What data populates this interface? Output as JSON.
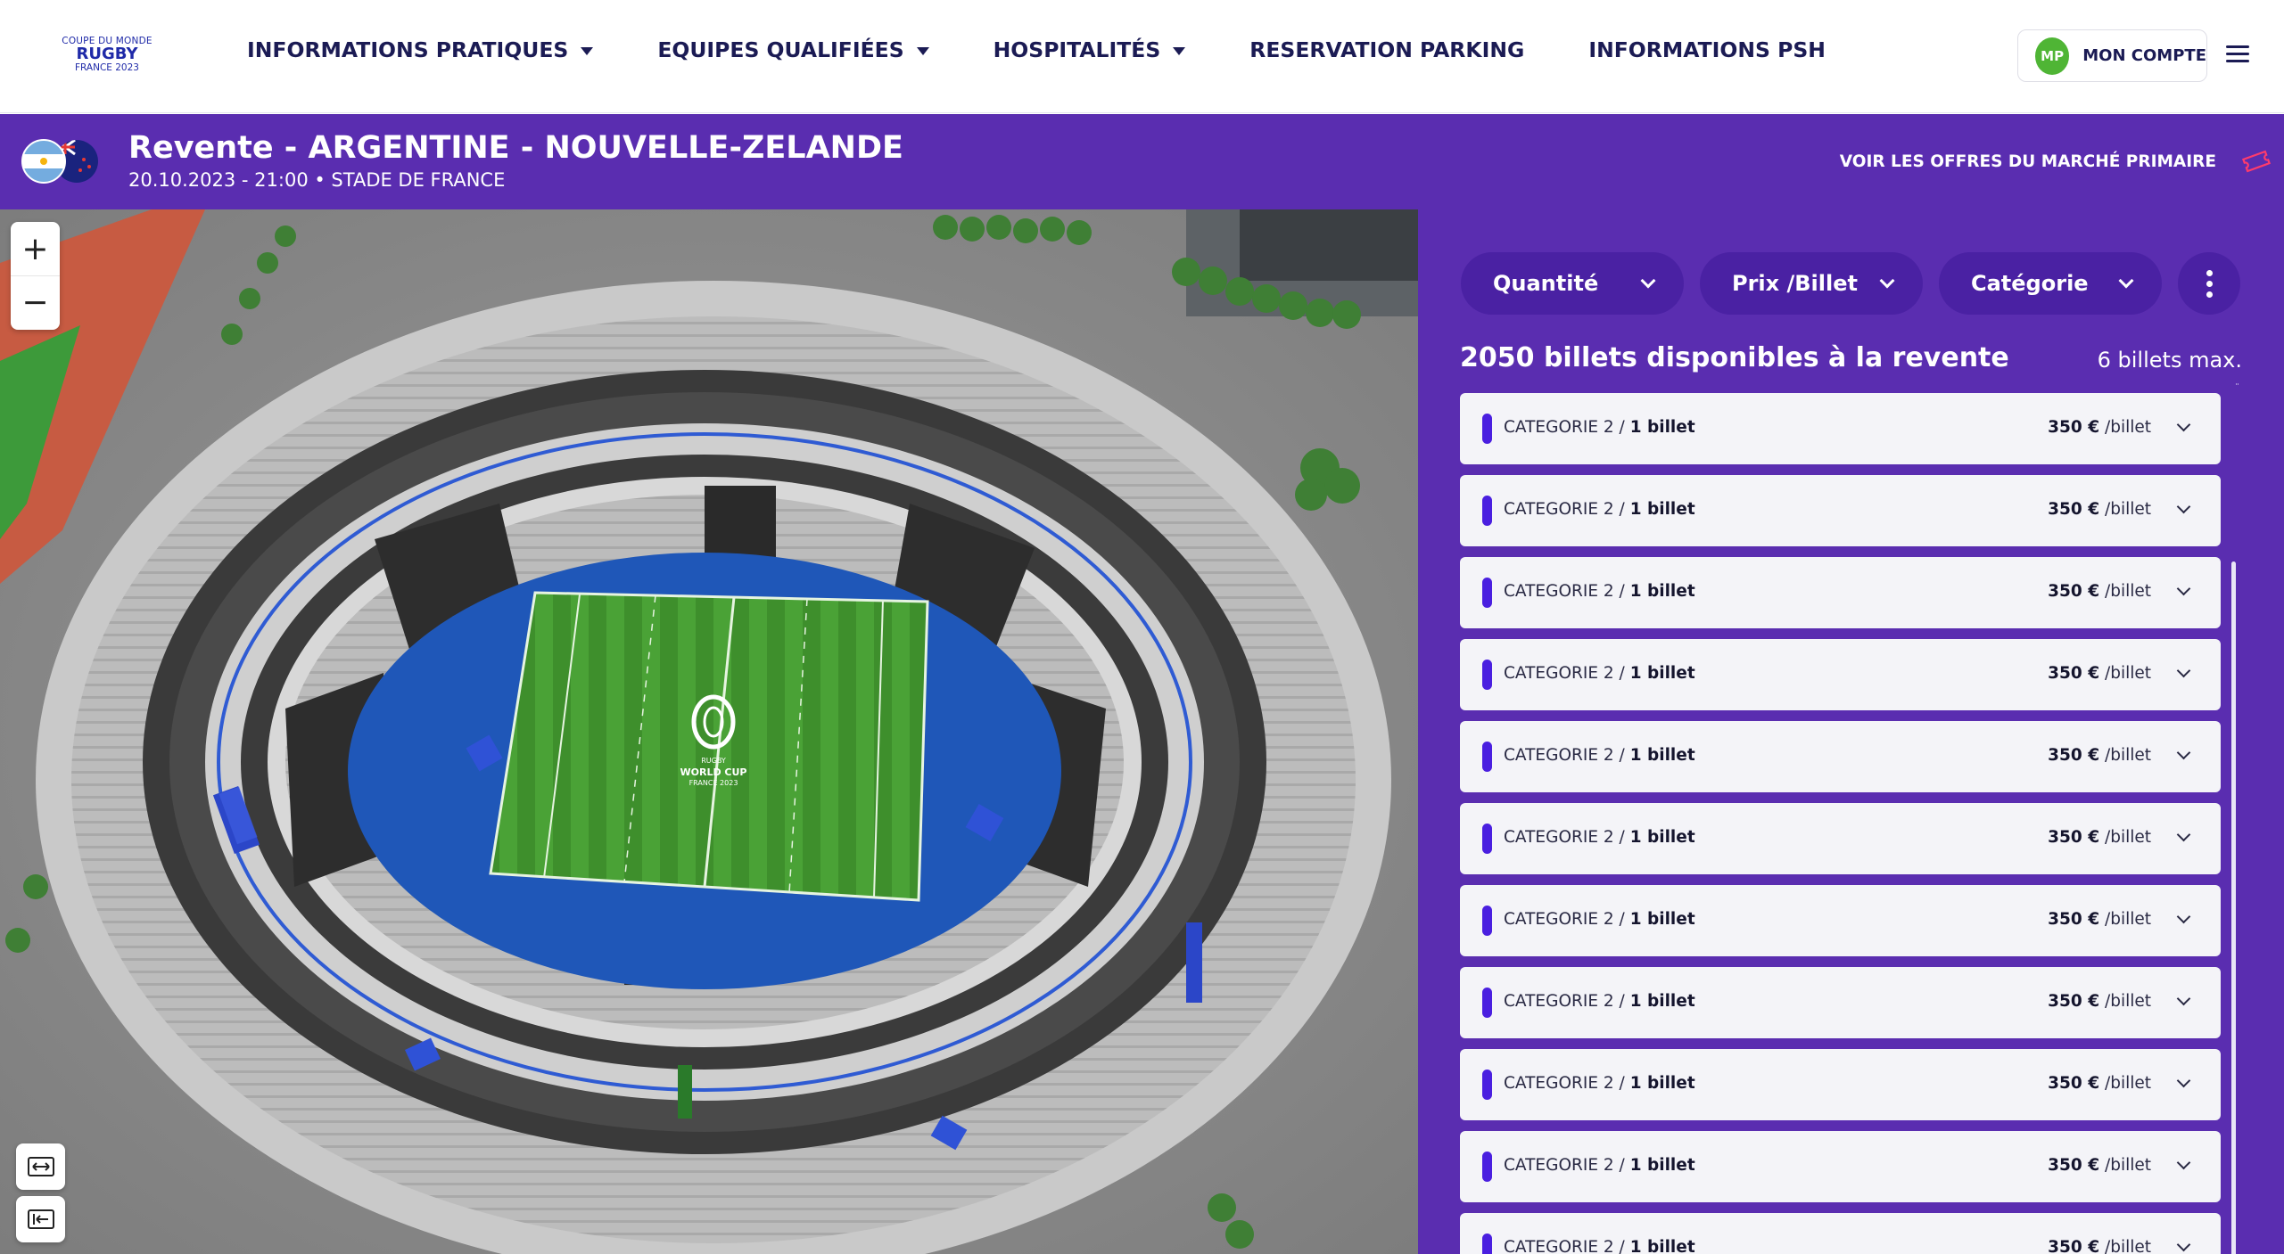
{
  "brand": {
    "logo_line1": "COUPE DU MONDE",
    "logo_line2": "RUGBY",
    "logo_line3": "FRANCE 2023"
  },
  "nav": {
    "items": [
      {
        "label": "INFORMATIONS PRATIQUES",
        "dropdown": true
      },
      {
        "label": "EQUIPES QUALIFIÉES",
        "dropdown": true
      },
      {
        "label": "HOSPITALITÉS",
        "dropdown": true
      },
      {
        "label": "RESERVATION PARKING",
        "dropdown": false
      },
      {
        "label": "INFORMATIONS PSH",
        "dropdown": false
      }
    ],
    "account_initials": "MP",
    "account_label": "MON COMPTE"
  },
  "event": {
    "title": "Revente - ARGENTINE - NOUVELLE-ZELANDE",
    "subtitle": "20.10.2023 - 21:00 • STADE DE FRANCE",
    "primary_market_link": "VOIR LES OFFRES DU MARCHÉ PRIMAIRE"
  },
  "map": {
    "zoom_in": "+",
    "zoom_out": "−",
    "pitch_logo_line1": "RUGBY",
    "pitch_logo_line2": "WORLD CUP",
    "pitch_logo_line3": "FRANCE 2023"
  },
  "filters": {
    "quantity": "Quantité",
    "price": "Prix /Billet",
    "category": "Catégorie"
  },
  "listing": {
    "available": "2050 billets disponibles à la revente",
    "max": "6 billets max.",
    "tickets": [
      {
        "category": "CATEGORIE 2 /",
        "qty": "1 billet",
        "price": "350 €",
        "unit": "/billet"
      },
      {
        "category": "CATEGORIE 2 /",
        "qty": "1 billet",
        "price": "350 €",
        "unit": "/billet"
      },
      {
        "category": "CATEGORIE 2 /",
        "qty": "1 billet",
        "price": "350 €",
        "unit": "/billet"
      },
      {
        "category": "CATEGORIE 2 /",
        "qty": "1 billet",
        "price": "350 €",
        "unit": "/billet"
      },
      {
        "category": "CATEGORIE 2 /",
        "qty": "1 billet",
        "price": "350 €",
        "unit": "/billet"
      },
      {
        "category": "CATEGORIE 2 /",
        "qty": "1 billet",
        "price": "350 €",
        "unit": "/billet"
      },
      {
        "category": "CATEGORIE 2 /",
        "qty": "1 billet",
        "price": "350 €",
        "unit": "/billet"
      },
      {
        "category": "CATEGORIE 2 /",
        "qty": "1 billet",
        "price": "350 €",
        "unit": "/billet"
      },
      {
        "category": "CATEGORIE 2 /",
        "qty": "1 billet",
        "price": "350 €",
        "unit": "/billet"
      },
      {
        "category": "CATEGORIE 2 /",
        "qty": "1 billet",
        "price": "350 €",
        "unit": "/billet"
      },
      {
        "category": "CATEGORIE 2 /",
        "qty": "1 billet",
        "price": "350 €",
        "unit": "/billet"
      }
    ]
  },
  "colors": {
    "brand_purple": "#5a2db0",
    "ticket_bar": "#4a1fe0",
    "nav_text": "#1b1b54",
    "account_green": "#4fb535"
  }
}
